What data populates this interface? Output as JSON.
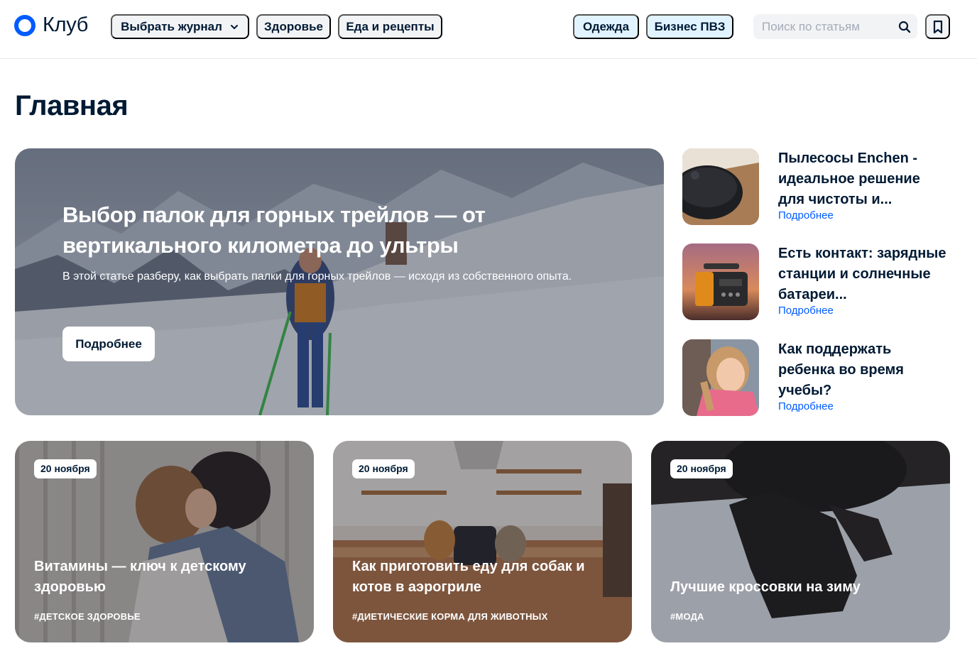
{
  "brand": {
    "name": "Клуб",
    "accent": "#005bff"
  },
  "nav": {
    "journal_select": "Выбрать журнал",
    "items": [
      "Здоровье",
      "Еда и рецепты"
    ],
    "highlight_items": [
      "Одежда",
      "Бизнес ПВЗ"
    ]
  },
  "search": {
    "placeholder": "Поиск по статьям",
    "icon": "search-icon"
  },
  "bookmarks": {
    "icon": "bookmark-icon"
  },
  "page_title": "Главная",
  "hero": {
    "title": "Выбор палок для горных трейлов — от вертикального километра до ультры",
    "description": "В этой статье разберу, как выбрать палки для горных трейлов — исходя из собственного опыта.",
    "button": "Подробнее"
  },
  "side_articles": [
    {
      "title": "Пылесосы Enchen - идеальное решение для чистоты и...",
      "more": "Подробнее"
    },
    {
      "title": "Есть контакт: зарядные станции и солнечные батареи...",
      "more": "Подробнее"
    },
    {
      "title": "Как поддержать ребенка во время учебы?",
      "more": "Подробнее"
    }
  ],
  "cards": [
    {
      "date": "20 ноября",
      "title": "Витамины — ключ к детскому здоровью",
      "tag": "#детское здоровье"
    },
    {
      "date": "20 ноября",
      "title": "Как приготовить еду для собак и котов в аэрогриле",
      "tag": "#диетические корма для животных"
    },
    {
      "date": "20 ноября",
      "title": "Лучшие кроссовки на зиму",
      "tag": "#мода"
    }
  ]
}
